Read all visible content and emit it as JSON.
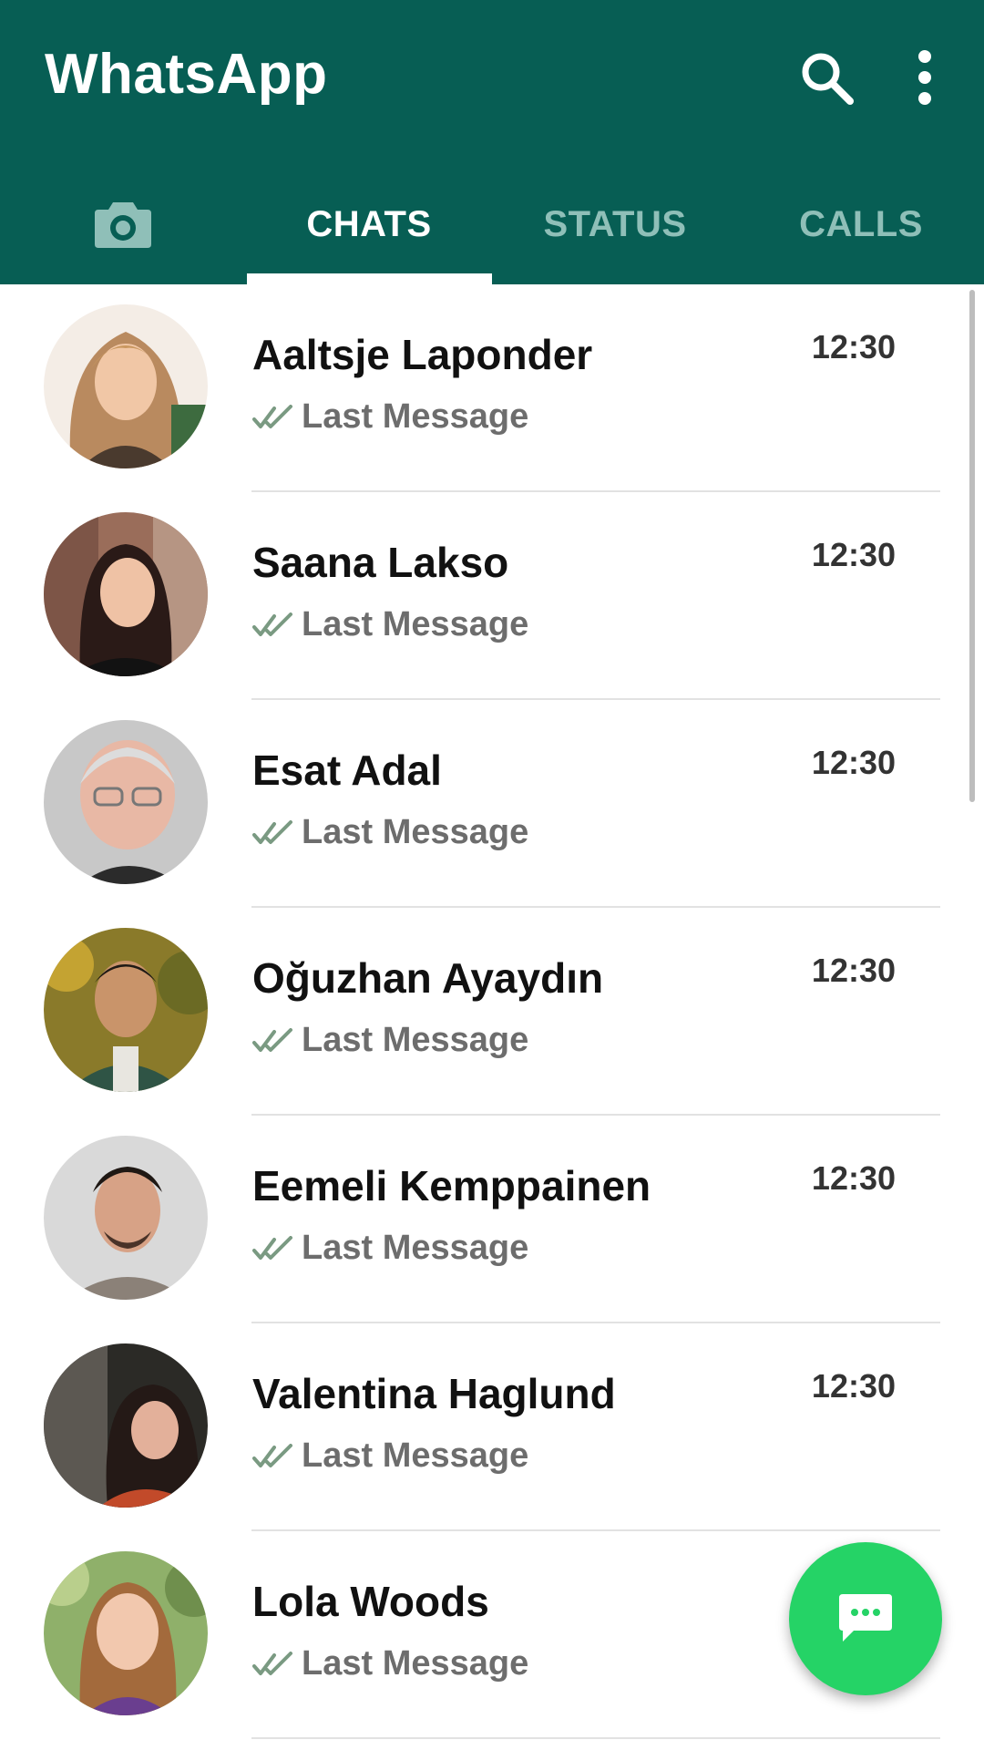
{
  "app": {
    "title": "WhatsApp",
    "colors": {
      "header": "#075e54",
      "tab_active": "#ffffff",
      "tab_inactive": "#8fbfb8",
      "fab": "#25d366",
      "tick": "#7a9a82"
    }
  },
  "header": {
    "search_icon": "search-icon",
    "menu_icon": "more-vertical-icon"
  },
  "tabs": [
    {
      "label": "",
      "icon": "camera-icon",
      "active": false
    },
    {
      "label": "CHATS",
      "active": true
    },
    {
      "label": "STATUS",
      "active": false
    },
    {
      "label": "CALLS",
      "active": false
    }
  ],
  "chats": [
    {
      "name": "Aaltsje Laponder",
      "time": "12:30",
      "message": "Last Message",
      "status_icon": "double-check-icon"
    },
    {
      "name": "Saana Lakso",
      "time": "12:30",
      "message": "Last Message",
      "status_icon": "double-check-icon"
    },
    {
      "name": "Esat Adal",
      "time": "12:30",
      "message": "Last Message",
      "status_icon": "double-check-icon"
    },
    {
      "name": "Oğuzhan Ayaydın",
      "time": "12:30",
      "message": "Last Message",
      "status_icon": "double-check-icon"
    },
    {
      "name": "Eemeli Kemppainen",
      "time": "12:30",
      "message": "Last Message",
      "status_icon": "double-check-icon"
    },
    {
      "name": "Valentina Haglund",
      "time": "12:30",
      "message": "Last Message",
      "status_icon": "double-check-icon"
    },
    {
      "name": "Lola Woods",
      "time": "",
      "message": "Last Message",
      "status_icon": "double-check-icon"
    }
  ],
  "fab": {
    "icon": "new-chat-icon"
  }
}
